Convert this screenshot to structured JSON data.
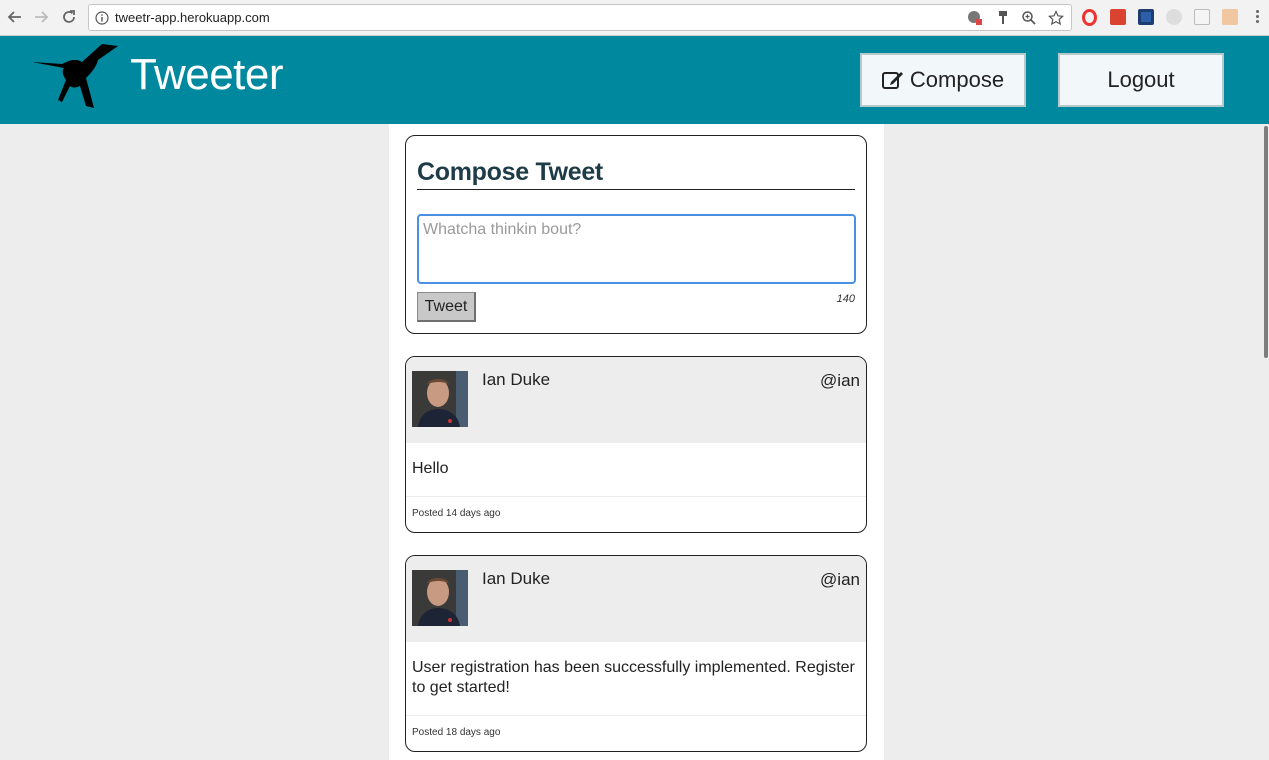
{
  "browser": {
    "url": "tweetr-app.herokuapp.com",
    "icons": [
      "back-icon",
      "forward-icon",
      "reload-icon",
      "info-icon",
      "translate-icon",
      "key-icon",
      "zoom-icon",
      "star-icon"
    ],
    "extensions": [
      "opera-extension",
      "bookmark-extension",
      "reader-extension",
      "moon-extension",
      "react-extension",
      "face-extension"
    ]
  },
  "header": {
    "brand": "Tweeter",
    "logo_icon": "hummingbird-icon",
    "compose_label": "Compose",
    "logout_label": "Logout",
    "accent_color": "#00889e"
  },
  "compose": {
    "title": "Compose Tweet",
    "placeholder": "Whatcha thinkin bout?",
    "value": "",
    "submit_label": "Tweet",
    "char_count": "140"
  },
  "tweets": [
    {
      "name": "Ian Duke",
      "handle": "@ian",
      "content": "Hello",
      "posted": "Posted 14 days ago"
    },
    {
      "name": "Ian Duke",
      "handle": "@ian",
      "content": "User registration has been successfully implemented. Register to get started!",
      "posted": "Posted 18 days ago"
    }
  ]
}
